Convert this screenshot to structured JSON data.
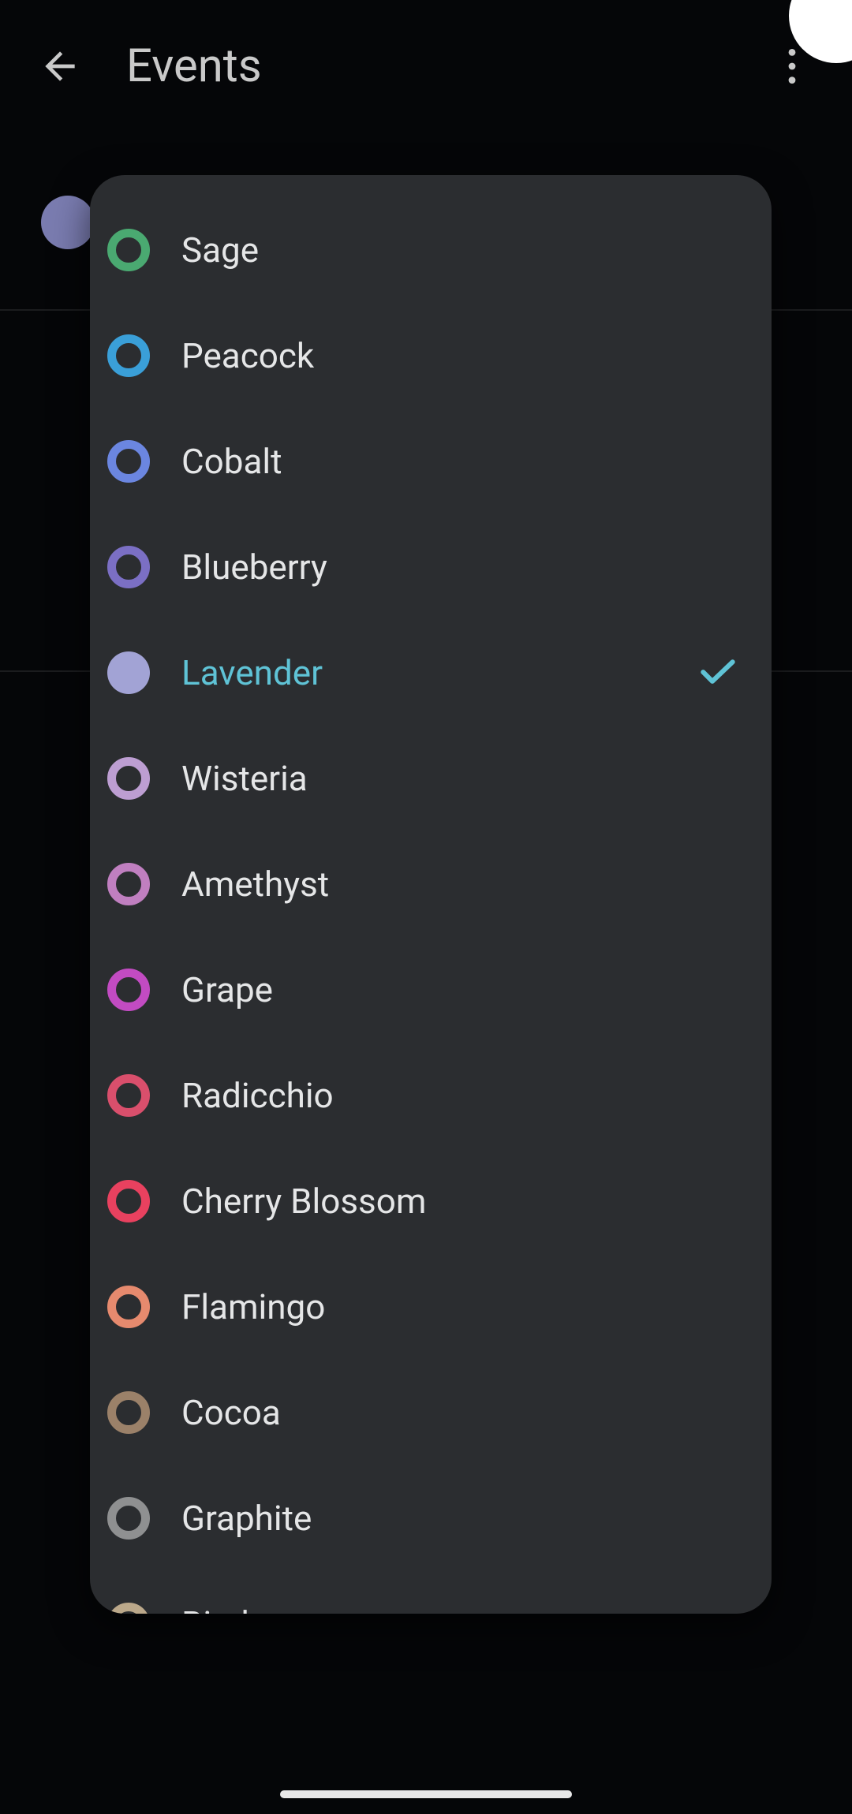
{
  "header": {
    "title": "Events"
  },
  "background": {
    "current_swatch_color": "#7a7cb0"
  },
  "dialog": {
    "selected_index": 4,
    "accent": "#5fc3d6",
    "options": [
      {
        "label": "Sage",
        "color": "#4aa971",
        "filled": false
      },
      {
        "label": "Peacock",
        "color": "#3a9fd8",
        "filled": false
      },
      {
        "label": "Cobalt",
        "color": "#6b86e0",
        "filled": false
      },
      {
        "label": "Blueberry",
        "color": "#7b6fc4",
        "filled": false
      },
      {
        "label": "Lavender",
        "color": "#a2a3d5",
        "filled": true
      },
      {
        "label": "Wisteria",
        "color": "#bd9ed2",
        "filled": false
      },
      {
        "label": "Amethyst",
        "color": "#c07fc0",
        "filled": false
      },
      {
        "label": "Grape",
        "color": "#c24bc2",
        "filled": false
      },
      {
        "label": "Radicchio",
        "color": "#d94f6c",
        "filled": false
      },
      {
        "label": "Cherry Blossom",
        "color": "#e8415f",
        "filled": false
      },
      {
        "label": "Flamingo",
        "color": "#e68a6e",
        "filled": false
      },
      {
        "label": "Cocoa",
        "color": "#9b8169",
        "filled": false
      },
      {
        "label": "Graphite",
        "color": "#8f9091",
        "filled": false
      },
      {
        "label": "Birch",
        "color": "#bba88a",
        "filled": false
      }
    ]
  }
}
